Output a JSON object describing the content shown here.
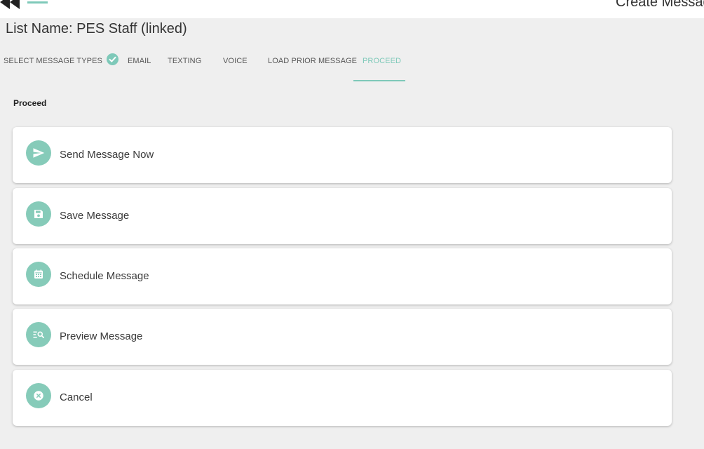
{
  "header": {
    "title": "Create Message"
  },
  "list": {
    "name": "List Name: PES Staff (linked)"
  },
  "tabs": [
    {
      "label": "SELECT MESSAGE TYPES"
    },
    {
      "label": "EMAIL",
      "checked": true
    },
    {
      "label": "TEXTING"
    },
    {
      "label": "VOICE"
    },
    {
      "label": "LOAD PRIOR MESSAGE"
    },
    {
      "label": "PROCEED",
      "active": true
    }
  ],
  "section": {
    "label": "Proceed"
  },
  "actions": [
    {
      "label": "Send Message Now",
      "icon": "send-icon"
    },
    {
      "label": "Save Message",
      "icon": "save-icon"
    },
    {
      "label": "Schedule Message",
      "icon": "calendar-icon"
    },
    {
      "label": "Preview Message",
      "icon": "preview-search-icon"
    },
    {
      "label": "Cancel",
      "icon": "cancel-icon"
    }
  ],
  "colors": {
    "accent": "#7ec9b9",
    "icon_circle": "#86cbb9",
    "background": "#efefef",
    "card": "#ffffff"
  }
}
